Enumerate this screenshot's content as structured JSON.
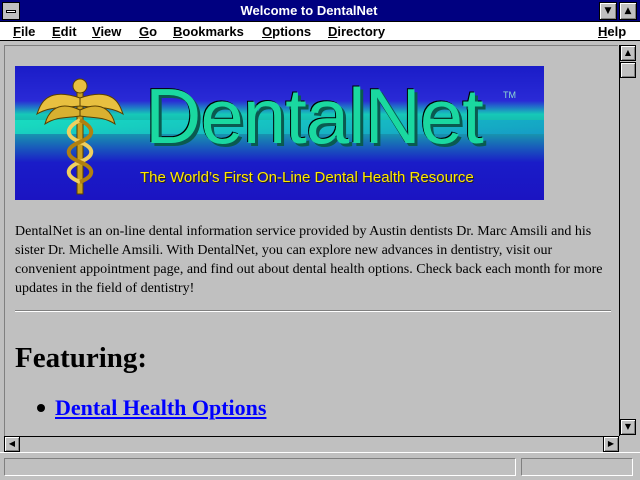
{
  "window": {
    "title": "Welcome to DentalNet",
    "minimize_glyph": "▼",
    "maximize_glyph": "▲"
  },
  "menubar": {
    "items": [
      {
        "label": "File",
        "accel": "F",
        "rest": "ile"
      },
      {
        "label": "Edit",
        "accel": "E",
        "rest": "dit"
      },
      {
        "label": "View",
        "accel": "V",
        "rest": "iew"
      },
      {
        "label": "Go",
        "accel": "G",
        "rest": "o"
      },
      {
        "label": "Bookmarks",
        "accel": "B",
        "rest": "ookmarks"
      },
      {
        "label": "Options",
        "accel": "O",
        "rest": "ptions"
      },
      {
        "label": "Directory",
        "accel": "D",
        "rest": "irectory"
      },
      {
        "label": "Help",
        "accel": "H",
        "rest": "elp"
      }
    ]
  },
  "page": {
    "banner": {
      "brand": "DentalNet",
      "trademark": "TM",
      "tagline": "The World’s First On-Line Dental Health Resource",
      "logo_icon": "caduceus-icon"
    },
    "intro": "DentalNet is an on-line dental information service provided by Austin dentists Dr. Marc Amsili and his sister Dr. Michelle Amsili. With DentalNet, you can explore new advances in dentistry, visit our convenient appointment page, and find out about dental health options. Check back each month for more updates in the field of dentistry!",
    "featuring_heading": "Featuring:",
    "featured_links": [
      "Dental Health Options"
    ]
  },
  "scrollbar": {
    "up": "▲",
    "down": "▼",
    "left": "◀",
    "right": "▶"
  },
  "statusbar": {
    "message": ""
  },
  "colors": {
    "titlebar": "#000080",
    "link": "#0000ff",
    "tagline": "#ffe800",
    "brand": "#1ad8a0"
  }
}
